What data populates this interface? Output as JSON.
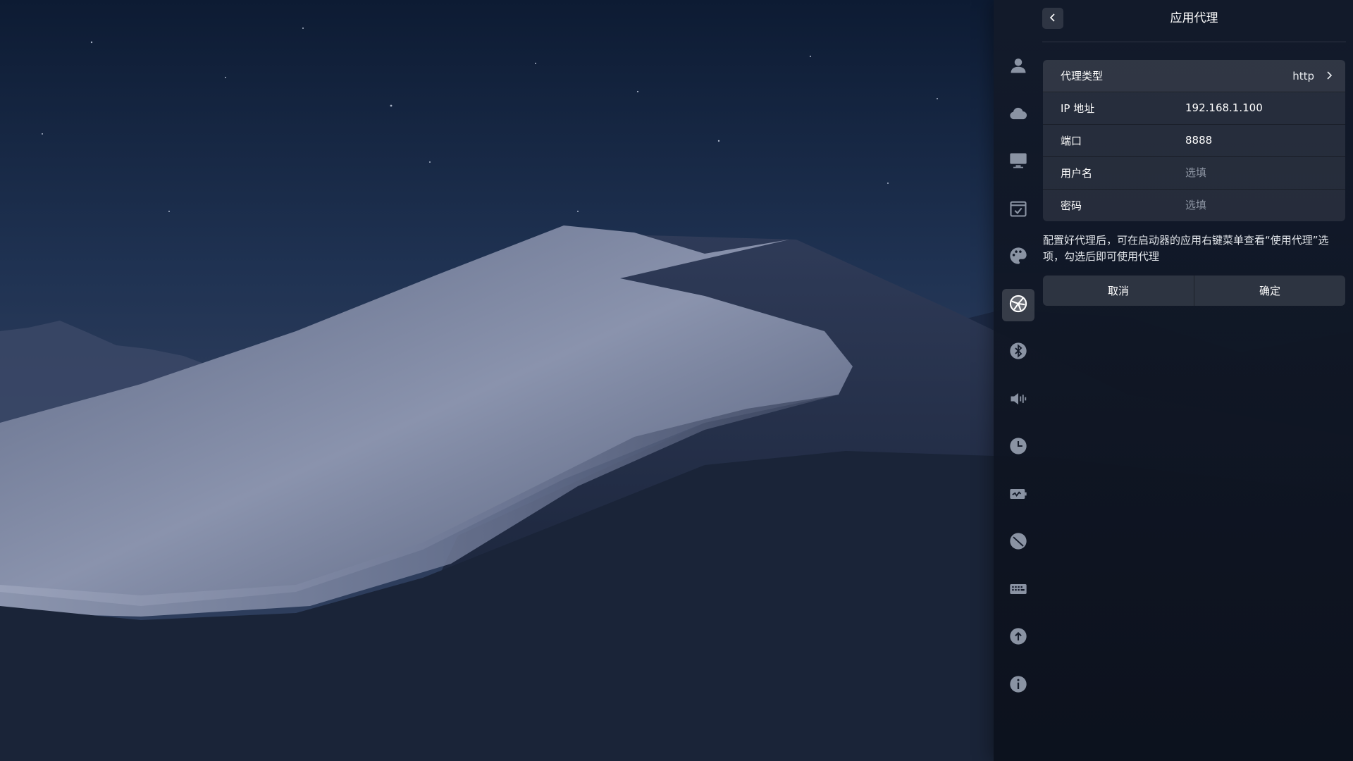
{
  "header": {
    "title": "应用代理"
  },
  "sidebar": {
    "items": [
      {
        "icon": "user-icon"
      },
      {
        "icon": "cloud-icon"
      },
      {
        "icon": "display-icon"
      },
      {
        "icon": "calendar-check-icon"
      },
      {
        "icon": "personalization-icon"
      },
      {
        "icon": "network-icon",
        "active": true
      },
      {
        "icon": "bluetooth-icon"
      },
      {
        "icon": "sound-icon"
      },
      {
        "icon": "clock-icon"
      },
      {
        "icon": "power-icon"
      },
      {
        "icon": "mouse-icon"
      },
      {
        "icon": "keyboard-icon"
      },
      {
        "icon": "update-icon"
      },
      {
        "icon": "info-icon"
      }
    ]
  },
  "form": {
    "proxy_type": {
      "label": "代理类型",
      "value": "http"
    },
    "ip": {
      "label": "IP 地址",
      "value": "192.168.1.100"
    },
    "port": {
      "label": "端口",
      "value": "8888"
    },
    "username": {
      "label": "用户名",
      "placeholder": "选填"
    },
    "password": {
      "label": "密码",
      "placeholder": "选填"
    }
  },
  "description": "配置好代理后，可在启动器的应用右键菜单查看“使用代理”选项，勾选后即可使用代理",
  "buttons": {
    "cancel": "取消",
    "confirm": "确定"
  },
  "colors": {
    "panel_bg": "#0e1421",
    "active_item": "#ffffff",
    "inactive_icon": "#8a93a3"
  }
}
